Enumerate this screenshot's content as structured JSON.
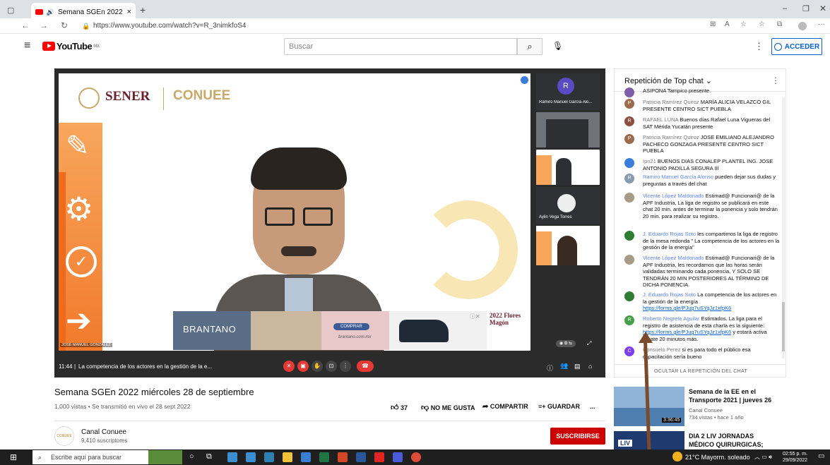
{
  "browser": {
    "tab_title": "Semana SGEn 2022 miérco",
    "url": "https://www.youtube.com/watch?v=R_3nimkfoS4"
  },
  "youtube": {
    "logo": "YouTube",
    "region": "MX",
    "search_placeholder": "Buscar",
    "signin_label": "ACCEDER"
  },
  "video": {
    "slide_sener": "SENER",
    "slide_conuee": "CONUEE",
    "presenter_tag": "JOSÉ MANUEL GONZÁLEZ",
    "time": "11:44",
    "caption": "La competencia de los actores en la gestión de la e...",
    "ad_brand": "BRANTANO",
    "ad_button": "COMPRAR",
    "ad_site": "brantano.com.mx",
    "ad_promo": "2022 Flores Magón",
    "participants": [
      {
        "name": "Ramiro Manuel García Alo...",
        "initial": "R"
      },
      {
        "name": ""
      },
      {
        "name": ""
      },
      {
        "name": "Aylin Vega Torres"
      },
      {
        "name": ""
      }
    ]
  },
  "chat": {
    "header": "Repetición de Top chat",
    "footer": "OCULTAR LA REPETICIÓN DEL CHAT",
    "messages": [
      {
        "author": "",
        "text": "ASIPONA Tampico presente.",
        "color": "#7b5ea7",
        "initial": ""
      },
      {
        "author": "Patricia Ramírez Quiroz",
        "text": "MARÍA ALICIA VELAZCO GIL PRESENTE CENTRO SICT PUEBLA",
        "color": "#9c6b4e",
        "initial": "P"
      },
      {
        "author": "RAFAEL LUNA",
        "text": "Buenos días Rafael Luna Vigueras del SAT Mérida Yucatán presente",
        "color": "#8d4f3f",
        "initial": "R"
      },
      {
        "author": "Patricia Ramírez Quiroz",
        "text": "JOSE EMILIANO ALEJANDRO PACHECO GONZAGA PRESENTE CENTRO SICT PUEBLA",
        "color": "#9c6b4e",
        "initial": "P"
      },
      {
        "author": "Ipn21",
        "text": "BUENOS DIAS CONALEP PLANTEL ING. JOSE ANTONIO PADILLA SEGURA III",
        "color": "#3b7dd8",
        "initial": ""
      },
      {
        "author": "Ramiro Manuel García Alonso",
        "text": "pueden dejar sus dudas y preguntas a través del chat",
        "color": "#8a9bb0",
        "initial": "R"
      },
      {
        "author": "Vicente López Maldonado",
        "text": "Estimad@ Funcionari@ de la APF Industria, La liga de registro se publicará en este chat 20 min. antes de terminar la ponencia y solo tendrán 20 min. para realizar su registro.",
        "color": "#a89a8a",
        "initial": ""
      },
      {
        "author": "J. Eduardo Rojas Soto",
        "text": "les compartimos la liga de registro de la mesa redonda \" La competencia de los actores en la gestión de la energía\"",
        "color": "#2e7d32",
        "initial": ""
      },
      {
        "author": "Vicente López Maldonado",
        "text": "Estimad@ Funcionari@ de la APF Industria, les recordamos que las horas serán validadas terminando cada ponencia, Y SOLO SE TENDRÁN 20 MIN POSTERIORES AL TÉRMINO DE DICHA PONENCIA.",
        "color": "#a89a8a",
        "initial": ""
      },
      {
        "author": "J. Eduardo Rojas Soto",
        "text": "La competencia de los actores en la gestión de la energía",
        "link": "https://forms.gle/PJug7uSYqJz1xfpK6",
        "color": "#2e7d32",
        "initial": ""
      },
      {
        "author": "Roberto Negrete Aguilar",
        "text": "Estimados. La liga para el registro de asistencia de esta charla es la siguiente:",
        "link": "https://forms.gle/PJug7uSYqJz1xfpK6",
        "text2": "y estará activa durate 20 minutos más.",
        "color": "#43a047",
        "initial": "R"
      },
      {
        "author": "Consuelo Perez",
        "text": "si es para todo el público esa capacitación sería bueno",
        "color": "#7e3ff2",
        "initial": "C"
      }
    ]
  },
  "info": {
    "title": "Semana SGEn 2022 miércoles 28 de septiembre",
    "views": "1,000 vistas • Se transmitió en vivo el 28 sept 2022",
    "likes": "37",
    "dislike": "NO ME GUSTA",
    "share": "COMPARTIR",
    "save": "GUARDAR",
    "more": "...",
    "channel": "Canal Conuee",
    "channel_short": "CONUEE",
    "subscribers": "9,410 suscriptores",
    "subscribe": "SUSCRIBIRSE"
  },
  "recommended": [
    {
      "title": "Semana de la EE en el Transporte 2021 | jueves 26",
      "channel": "Canal Conuee",
      "meta": "734 vistas • hace 1 año",
      "duration": "3:36:45"
    },
    {
      "title": "DIA 2 LIV JORNADAS MÉDICO QUIRURGICAS; DESAFÍOS DE...",
      "channel": "",
      "meta": "",
      "thumb_label": "LIV"
    }
  ],
  "taskbar": {
    "search": "Escribe aquí para buscar",
    "weather": "21°C Mayorm. soleado",
    "time": "02:55 p. m.",
    "date": "29/09/2022"
  }
}
